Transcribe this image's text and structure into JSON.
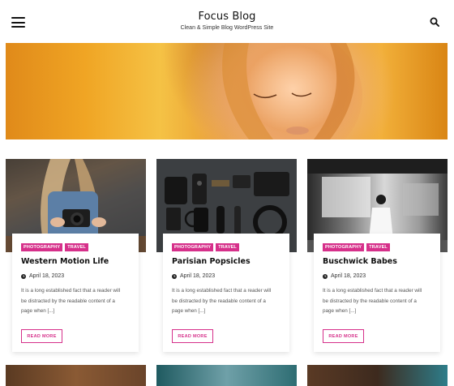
{
  "header": {
    "site_title": "Focus Blog",
    "tagline": "Clean & Simple Blog WordPress Site",
    "menu_icon": "hamburger-menu-icon",
    "search_icon": "search-icon"
  },
  "accent_color": "#d6308a",
  "posts": [
    {
      "tags": [
        "PHOTOGRAPHY",
        "TRAVEL"
      ],
      "title": "Western Motion Life",
      "date": "April 18, 2023",
      "excerpt": "It is a long established fact that a reader will be distracted by the readable content of a page when [...]",
      "read_more": "READ MORE"
    },
    {
      "tags": [
        "PHOTOGRAPHY",
        "TRAVEL"
      ],
      "title": "Parisian Popsicles",
      "date": "April 18, 2023",
      "excerpt": "It is a long established fact that a reader will be distracted by the readable content of a page when [...]",
      "read_more": "READ MORE"
    },
    {
      "tags": [
        "PHOTOGRAPHY",
        "TRAVEL"
      ],
      "title": "Buschwick Babes",
      "date": "April 18, 2023",
      "excerpt": "It is a long established fact that a reader will be distracted by the readable content of a page when [...]",
      "read_more": "READ MORE"
    }
  ]
}
